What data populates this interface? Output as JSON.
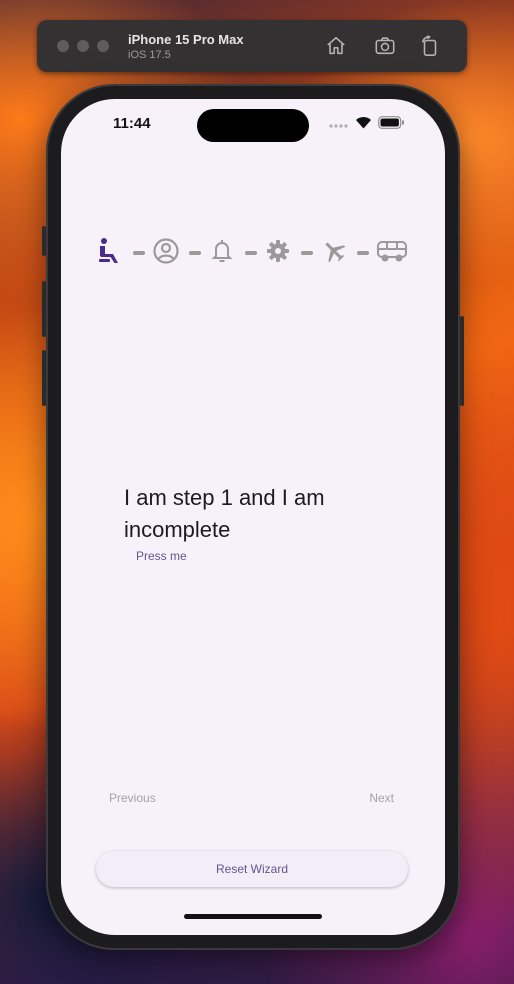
{
  "simulator": {
    "device": "iPhone 15 Pro Max",
    "os": "iOS 17.5",
    "buttons": [
      "home-icon",
      "screenshot-icon",
      "rotate-icon"
    ]
  },
  "status_bar": {
    "time": "11:44"
  },
  "stepper": {
    "active_color": "#4a2c8f",
    "inactive_color": "#9a9a9a",
    "active_index": 0,
    "steps": [
      {
        "icon": "seat-icon"
      },
      {
        "icon": "account-circle-icon"
      },
      {
        "icon": "bell-icon"
      },
      {
        "icon": "gear-icon"
      },
      {
        "icon": "airplane-icon"
      },
      {
        "icon": "bus-icon"
      }
    ]
  },
  "content": {
    "step_text": "I am step 1 and I am incomplete",
    "press_button": "Press me"
  },
  "navigation": {
    "previous": "Previous",
    "next": "Next"
  },
  "reset_button": "Reset Wizard"
}
